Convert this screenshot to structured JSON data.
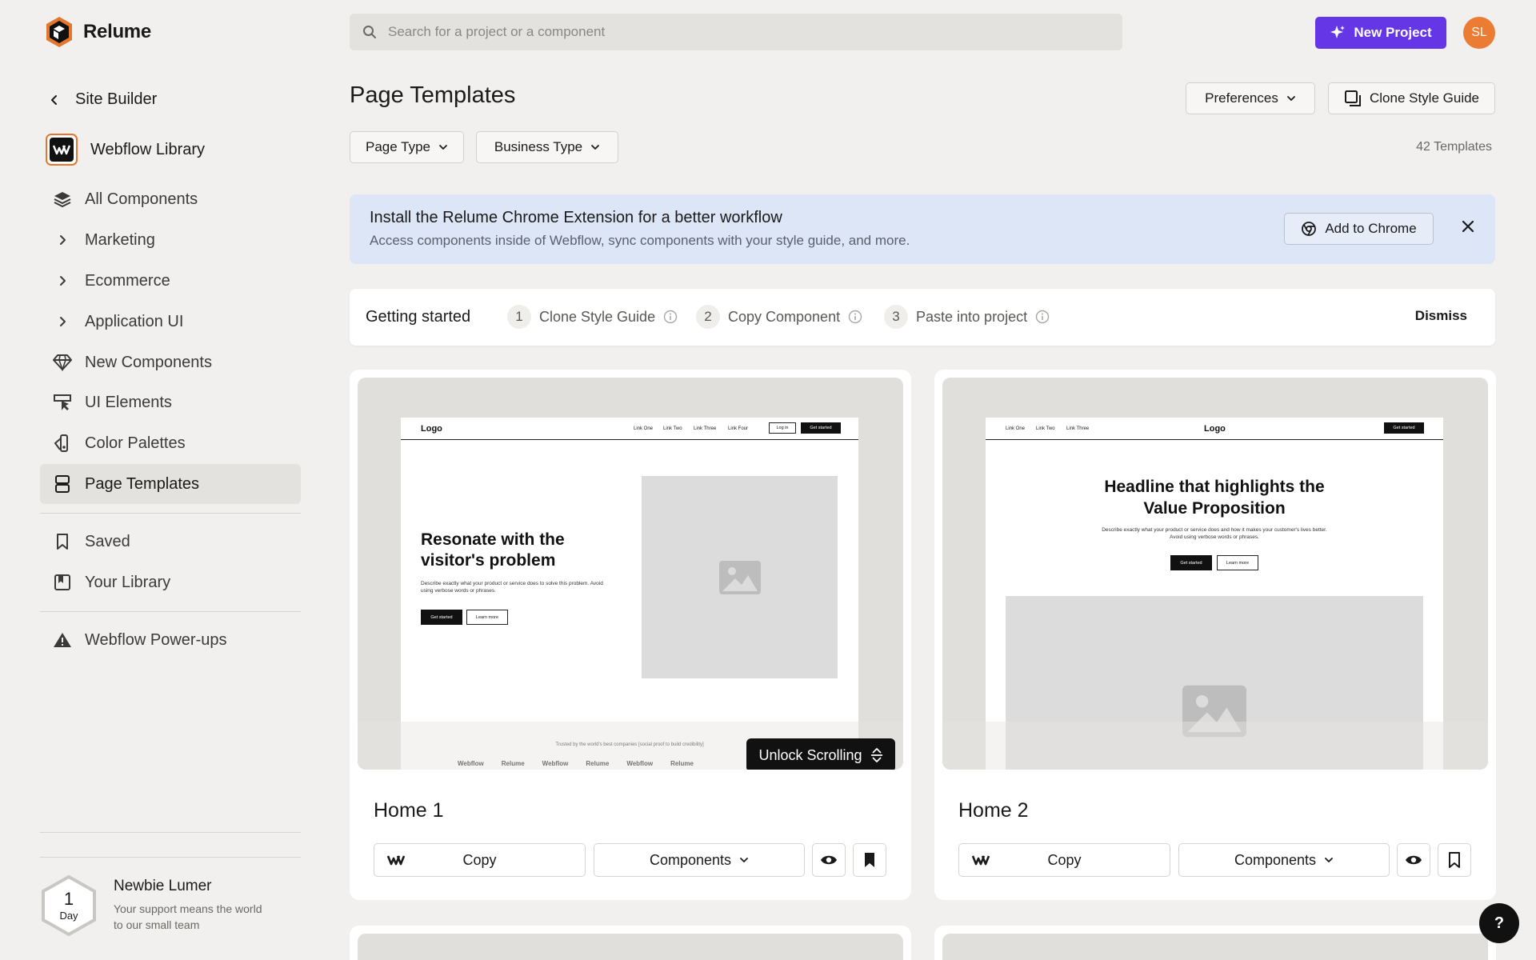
{
  "app": {
    "name": "Relume"
  },
  "search": {
    "placeholder": "Search for a project or a component"
  },
  "header": {
    "new_project": "New Project",
    "avatar_initials": "SL"
  },
  "sidebar": {
    "back_label": "Site Builder",
    "library_label": "Webflow Library",
    "items": [
      {
        "label": "All Components",
        "icon": "layers-icon"
      },
      {
        "label": "Marketing",
        "icon": "chevron-right-icon"
      },
      {
        "label": "Ecommerce",
        "icon": "chevron-right-icon"
      },
      {
        "label": "Application UI",
        "icon": "chevron-right-icon"
      },
      {
        "label": "New Components",
        "icon": "diamond-icon"
      },
      {
        "label": "UI Elements",
        "icon": "cursor-box-icon"
      },
      {
        "label": "Color Palettes",
        "icon": "palette-icon"
      },
      {
        "label": "Page Templates",
        "icon": "template-icon",
        "active": true
      }
    ],
    "secondary": [
      {
        "label": "Saved",
        "icon": "bookmark-icon"
      },
      {
        "label": "Your Library",
        "icon": "library-icon"
      }
    ],
    "powerups": {
      "label": "Webflow Power-ups",
      "icon": "warning-triangle-icon"
    },
    "badge": {
      "number": "1",
      "unit": "Day",
      "title": "Newbie Lumer",
      "subtitle": "Your support means the world to our small team"
    }
  },
  "main": {
    "title": "Page Templates",
    "preferences": "Preferences",
    "clone_style_guide": "Clone Style Guide",
    "filters": {
      "page_type": "Page Type",
      "business_type": "Business Type"
    },
    "template_count": "42 Templates",
    "banner": {
      "title": "Install the Relume Chrome Extension for a better workflow",
      "subtitle": "Access components inside of Webflow, sync components with your style guide, and more.",
      "button": "Add to Chrome"
    },
    "getting_started": {
      "title": "Getting started",
      "steps": [
        {
          "num": "1",
          "label": "Clone Style Guide"
        },
        {
          "num": "2",
          "label": "Copy Component"
        },
        {
          "num": "3",
          "label": "Paste into project"
        }
      ],
      "dismiss": "Dismiss"
    },
    "cards": [
      {
        "title": "Home 1",
        "copy": "Copy",
        "components": "Components",
        "unlock": "Unlock Scrolling",
        "preview": {
          "logo": "Logo",
          "links": [
            "Link One",
            "Link Two",
            "Link Three",
            "Link Four"
          ],
          "login": "Log in",
          "cta": "Get started",
          "headline": "Resonate with the visitor's problem",
          "body": "Describe exactly what your product or service does to solve this problem. Avoid using verbose words or phrases.",
          "primary": "Get started",
          "secondary": "Learn more",
          "trusted": "Trusted by the world's best companies [social proof to build credibility]",
          "brands": [
            "Webflow",
            "Relume",
            "Webflow",
            "Relume",
            "Webflow",
            "Relume"
          ]
        }
      },
      {
        "title": "Home 2",
        "copy": "Copy",
        "components": "Components",
        "preview": {
          "logo": "Logo",
          "links": [
            "Link One",
            "Link Two",
            "Link Three"
          ],
          "cta": "Get started",
          "headline": "Headline that highlights the Value Proposition",
          "body": "Describe exactly what your product or service does and how it makes your customer's lives better. Avoid using verbose words or phrases.",
          "primary": "Get started",
          "secondary": "Learn more"
        }
      }
    ]
  },
  "help": "?",
  "colors": {
    "accent": "#6536e6",
    "avatar": "#ea7c33",
    "banner": "#dde6f6",
    "background": "#f1f0ee"
  }
}
